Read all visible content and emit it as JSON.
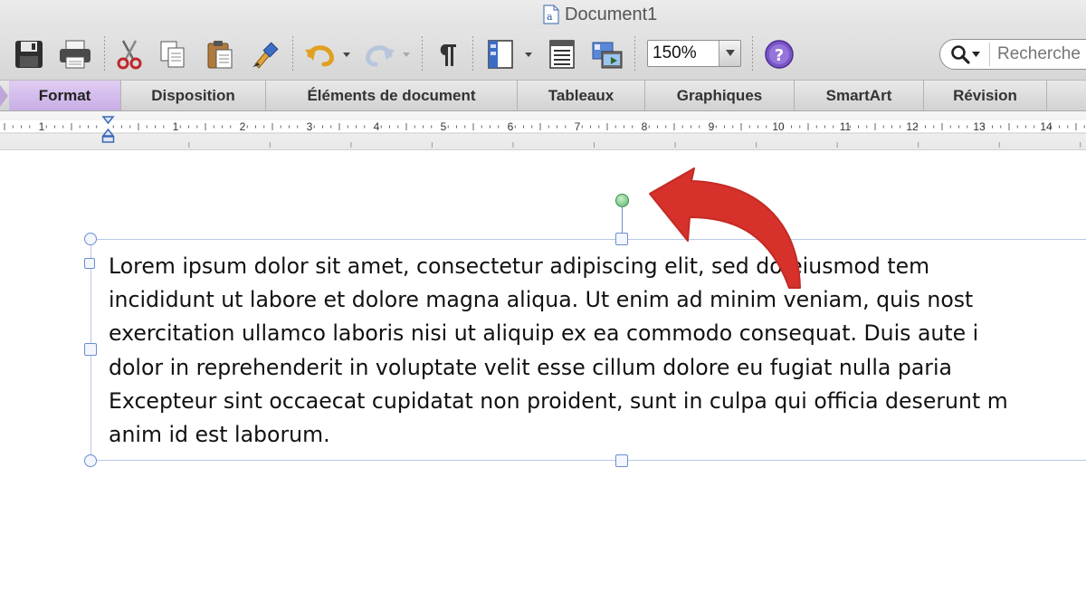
{
  "window": {
    "title": "Document1"
  },
  "toolbar": {
    "zoom_value": "150%",
    "search_placeholder": "Recherche"
  },
  "ribbon": {
    "tabs": [
      {
        "label": "Format",
        "active": true
      },
      {
        "label": "Disposition"
      },
      {
        "label": "Éléments de document"
      },
      {
        "label": "Tableaux"
      },
      {
        "label": "Graphiques"
      },
      {
        "label": "SmartArt"
      },
      {
        "label": "Révision"
      }
    ]
  },
  "ruler": {
    "labels": [
      "1",
      "1",
      "2",
      "3",
      "4",
      "5",
      "6",
      "7",
      "8",
      "9",
      "10",
      "11",
      "12",
      "13",
      "14"
    ]
  },
  "document": {
    "lines": [
      "Lorem ipsum dolor sit amet, consectetur adipiscing elit, sed do eiusmod tem",
      "incididunt ut labore et dolore magna aliqua. Ut enim ad minim veniam, quis nost",
      "exercitation ullamco laboris nisi ut aliquip ex ea commodo consequat. Duis aute i",
      "dolor in reprehenderit in voluptate velit esse cillum dolore eu fugiat nulla paria",
      "Excepteur sint occaecat cupidatat non proident, sunt in culpa qui officia deserunt m",
      "anim id est laborum."
    ]
  },
  "colors": {
    "accent_tab": "#c9aee6",
    "selection": "#6b8ed0",
    "rotate_handle": "#57b56b",
    "annotation_arrow": "#d6312b"
  }
}
